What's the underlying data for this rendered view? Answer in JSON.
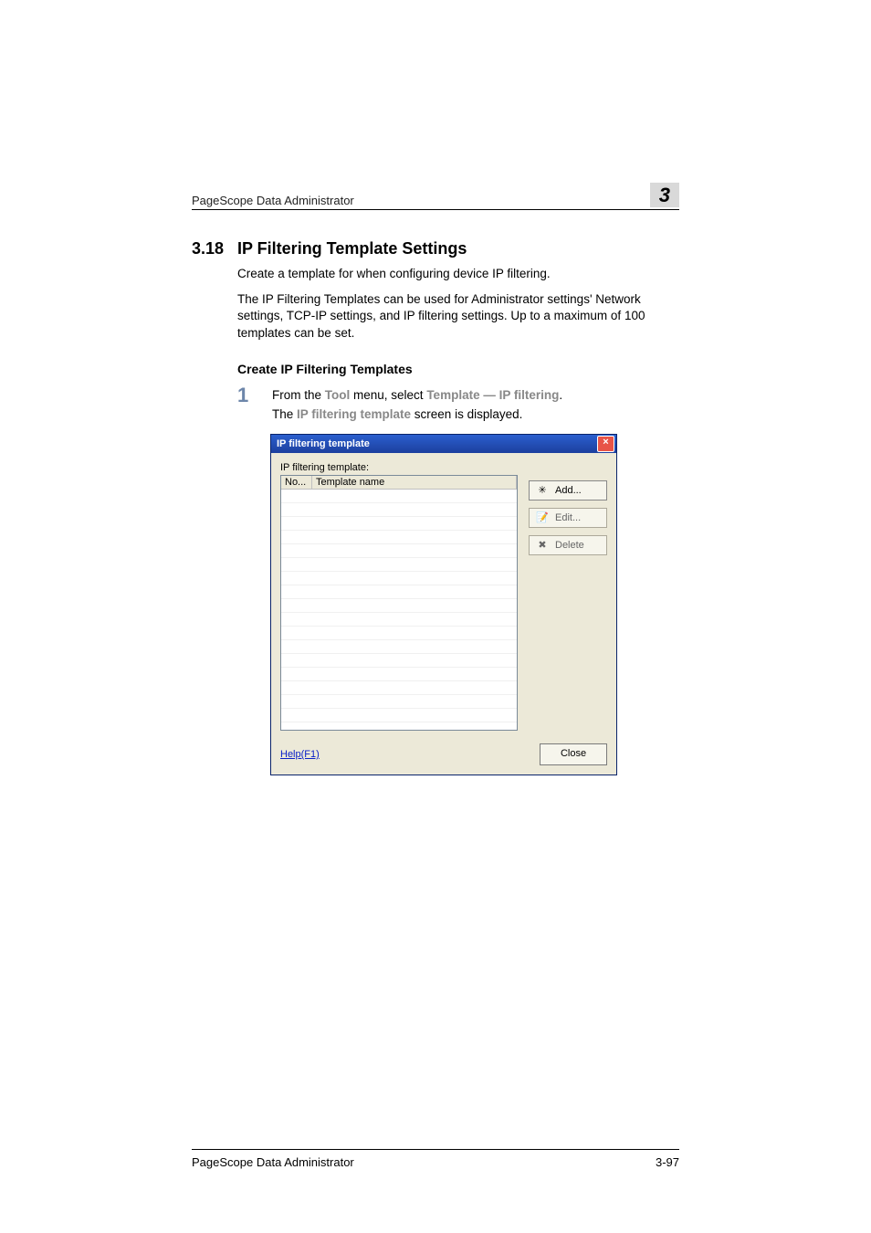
{
  "header": {
    "doc_title": "PageScope Data Administrator",
    "chapter_number": "3"
  },
  "section": {
    "number": "3.18",
    "title": "IP Filtering Template Settings"
  },
  "paragraphs": {
    "intro1": "Create a template for when configuring device IP filtering.",
    "intro2": "The IP Filtering Templates can be used for Administrator settings' Network settings, TCP-IP settings, and IP filtering settings. Up to a maximum of 100 templates can be set."
  },
  "subhead": "Create IP Filtering Templates",
  "step1": {
    "number": "1",
    "pre": "From the ",
    "menu_tool": "Tool",
    "mid": " menu, select ",
    "menu_template": "Template",
    "dash": " — ",
    "menu_item": "IP filtering",
    "end": ".",
    "result_pre": "The ",
    "result_emph": "IP filtering template",
    "result_post": " screen is displayed."
  },
  "dialog": {
    "title": "IP filtering template",
    "list_label": "IP filtering template:",
    "columns": {
      "no": "No...",
      "name": "Template name"
    },
    "row_count": 18,
    "buttons": {
      "add": "Add...",
      "edit": "Edit...",
      "delete": "Delete"
    },
    "help_link": "Help(F1)",
    "close": "Close"
  },
  "footer": {
    "left": "PageScope Data Administrator",
    "right": "3-97"
  }
}
